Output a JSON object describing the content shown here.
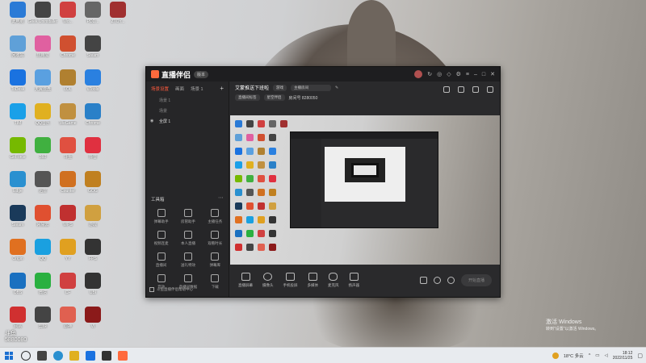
{
  "desktop": {
    "icons": [
      {
        "label": "此电脑",
        "color": "#2a7ad6",
        "col": 0,
        "row": 0
      },
      {
        "label": "Geek Uninstaller",
        "color": "#444",
        "col": 1,
        "row": 0
      },
      {
        "label": "Wo...",
        "color": "#d04040",
        "col": 2,
        "row": 0
      },
      {
        "label": "PDD...",
        "color": "#666",
        "col": 3,
        "row": 0
      },
      {
        "label": "ZTOY...",
        "color": "#a03030",
        "col": 4,
        "row": 0
      },
      {
        "label": "回收站",
        "color": "#5fa0d8",
        "col": 0,
        "row": 1
      },
      {
        "label": "应用宝",
        "color": "#e060a0",
        "col": 1,
        "row": 1
      },
      {
        "label": "Chrome",
        "color": "#d05030",
        "col": 2,
        "row": 1
      },
      {
        "label": "Steam",
        "color": "#444",
        "col": 3,
        "row": 1
      },
      {
        "label": "ToDesk",
        "color": "#1a72e0",
        "col": 0,
        "row": 2
      },
      {
        "label": "天翼云盘",
        "color": "#5aa0e0",
        "col": 1,
        "row": 2
      },
      {
        "label": "LOL",
        "color": "#b08030",
        "col": 2,
        "row": 2
      },
      {
        "label": "uTools",
        "color": "#2a80e0",
        "col": 3,
        "row": 2
      },
      {
        "label": "TIM",
        "color": "#1aa0e8",
        "col": 0,
        "row": 3
      },
      {
        "label": "QQ音乐",
        "color": "#e0b020",
        "col": 1,
        "row": 3
      },
      {
        "label": "WeGame",
        "color": "#c09040",
        "col": 2,
        "row": 3
      },
      {
        "label": "Chrome",
        "color": "#2a80c8",
        "col": 3,
        "row": 3
      },
      {
        "label": "GeForce",
        "color": "#76b900",
        "col": 0,
        "row": 4
      },
      {
        "label": "360",
        "color": "#40b040",
        "col": 1,
        "row": 4
      },
      {
        "label": "斗鱼",
        "color": "#e05040",
        "col": 2,
        "row": 4
      },
      {
        "label": "抖音",
        "color": "#e03040",
        "col": 3,
        "row": 4
      },
      {
        "label": "Edge",
        "color": "#2a90d0",
        "col": 0,
        "row": 5
      },
      {
        "label": "迅雷",
        "color": "#555",
        "col": 1,
        "row": 5
      },
      {
        "label": "Counter",
        "color": "#d07020",
        "col": 2,
        "row": 5
      },
      {
        "label": "GOG",
        "color": "#c08020",
        "col": 3,
        "row": 5
      },
      {
        "label": "Steam",
        "color": "#1a3a5a",
        "col": 0,
        "row": 6
      },
      {
        "label": "网易云",
        "color": "#e05030",
        "col": 1,
        "row": 6
      },
      {
        "label": "WPS",
        "color": "#c03030",
        "col": 2,
        "row": 6
      },
      {
        "label": "游戏",
        "color": "#d0a040",
        "col": 3,
        "row": 6
      },
      {
        "label": "Origin",
        "color": "#e07020",
        "col": 0,
        "row": 7
      },
      {
        "label": "QQ",
        "color": "#1aa0e0",
        "col": 1,
        "row": 7
      },
      {
        "label": "YY",
        "color": "#e0a020",
        "col": 2,
        "row": 7
      },
      {
        "label": "FPS",
        "color": "#333",
        "col": 3,
        "row": 7
      },
      {
        "label": "OBS",
        "color": "#1a70c0",
        "col": 0,
        "row": 8
      },
      {
        "label": "微信",
        "color": "#2ab040",
        "col": 1,
        "row": 8
      },
      {
        "label": "CF",
        "color": "#d04040",
        "col": 2,
        "row": 8
      },
      {
        "label": "UBI",
        "color": "#333",
        "col": 3,
        "row": 8
      },
      {
        "label": "网易",
        "color": "#d03030",
        "col": 0,
        "row": 9
      },
      {
        "label": "剪映",
        "color": "#444",
        "col": 1,
        "row": 9
      },
      {
        "label": "原神",
        "color": "#e06050",
        "col": 2,
        "row": 9
      },
      {
        "label": "VI",
        "color": "#8b1a1a",
        "col": 3,
        "row": 9
      }
    ],
    "watermark_line1": "斗鱼",
    "watermark_line2": "5880080"
  },
  "app": {
    "title": "直播伴侣",
    "badge": "版本",
    "tabs": [
      "场景设置",
      "画面",
      "场景 1"
    ],
    "scenes": [
      {
        "name": "场景 1",
        "selected": false
      },
      {
        "name": "场景",
        "selected": false
      },
      {
        "name": "全屏 1",
        "selected": true
      }
    ],
    "tools_title": "工具箱",
    "tools": [
      "弹幕助手",
      "房管助手",
      "主播任务",
      "视频连麦",
      "本人直播",
      "观看时长",
      "直播间",
      "送礼特效",
      "弹幕库",
      "音效",
      "直播间数据",
      "下载"
    ],
    "left_footer": "斗鱼直播伴侣帮助中心",
    "room_title": "艾蒙推送下班啦",
    "room_pill1": "游戏",
    "room_pill2": "主播房间",
    "room_row2_pill1": "直播间标签",
    "room_row2_pill2": "星空伴侣",
    "room_id": "房间号 8280050",
    "controls": [
      "直播屏幕",
      "摄像头",
      "手机投屏",
      "多媒体",
      "麦克风",
      "扬声器"
    ],
    "go_live": "开始直播"
  },
  "taskbar": {
    "weather": "18°C 多云",
    "time": "18:12",
    "date": "2022/11/25"
  },
  "activate": {
    "line1": "激活 Windows",
    "line2": "转到\"设置\"以激活 Windows。"
  }
}
